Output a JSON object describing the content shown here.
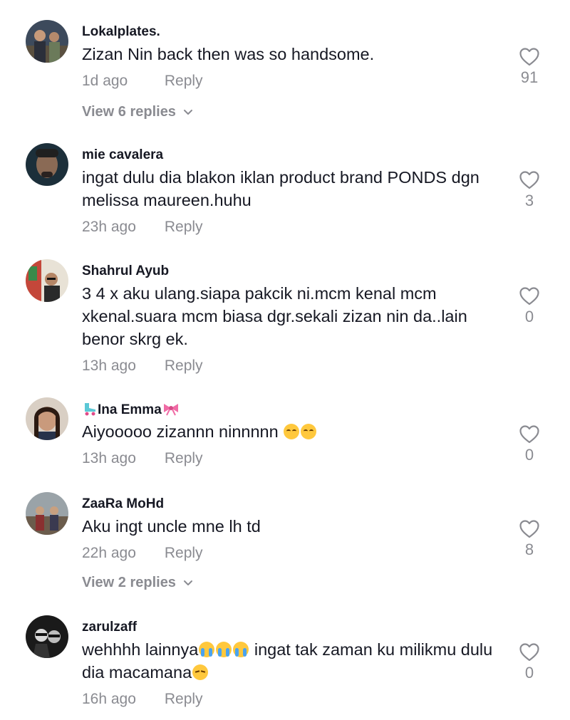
{
  "comments": [
    {
      "username": "Lokalplates.",
      "text": "Zizan Nin back then was so handsome.",
      "time": "1d ago",
      "reply_label": "Reply",
      "likes": "91",
      "view_replies": "View 6 replies"
    },
    {
      "username": "mie cavalera",
      "text": "ingat dulu dia blakon iklan product brand PONDS dgn melissa maureen.huhu",
      "time": "23h ago",
      "reply_label": "Reply",
      "likes": "3"
    },
    {
      "username": "Shahrul Ayub",
      "text": "3 4 x aku ulang.siapa pakcik ni.mcm kenal mcm xkenal.suara mcm biasa dgr.sekali zizan nin da..lain benor skrg ek.",
      "time": "13h ago",
      "reply_label": "Reply",
      "likes": "0"
    },
    {
      "username": "Ina Emma",
      "text": "Aiyooooo zizannn ninnnnn",
      "time": "13h ago",
      "reply_label": "Reply",
      "likes": "0"
    },
    {
      "username": "ZaaRa MoHd",
      "text": "Aku ingt uncle mne lh td",
      "time": "22h ago",
      "reply_label": "Reply",
      "likes": "8",
      "view_replies": "View 2 replies"
    },
    {
      "username": "zarulzaff",
      "text_a": "wehhhh lainnya",
      "text_b": " ingat tak zaman ku milikmu dulu dia macamana",
      "time": "16h ago",
      "reply_label": "Reply",
      "likes": "0"
    }
  ],
  "icons": {
    "like": "heart-outline-icon",
    "expand": "chevron-down-icon",
    "emoji_sweat": "grinning-sweat-emoji",
    "emoji_cry": "loudly-crying-emoji",
    "emoji_pensive": "pensive-emoji",
    "roller_skate": "roller-skate-emoji",
    "ribbon": "ribbon-emoji"
  },
  "colors": {
    "text_primary": "#161823",
    "text_secondary": "#8a8b91",
    "background": "#ffffff"
  }
}
